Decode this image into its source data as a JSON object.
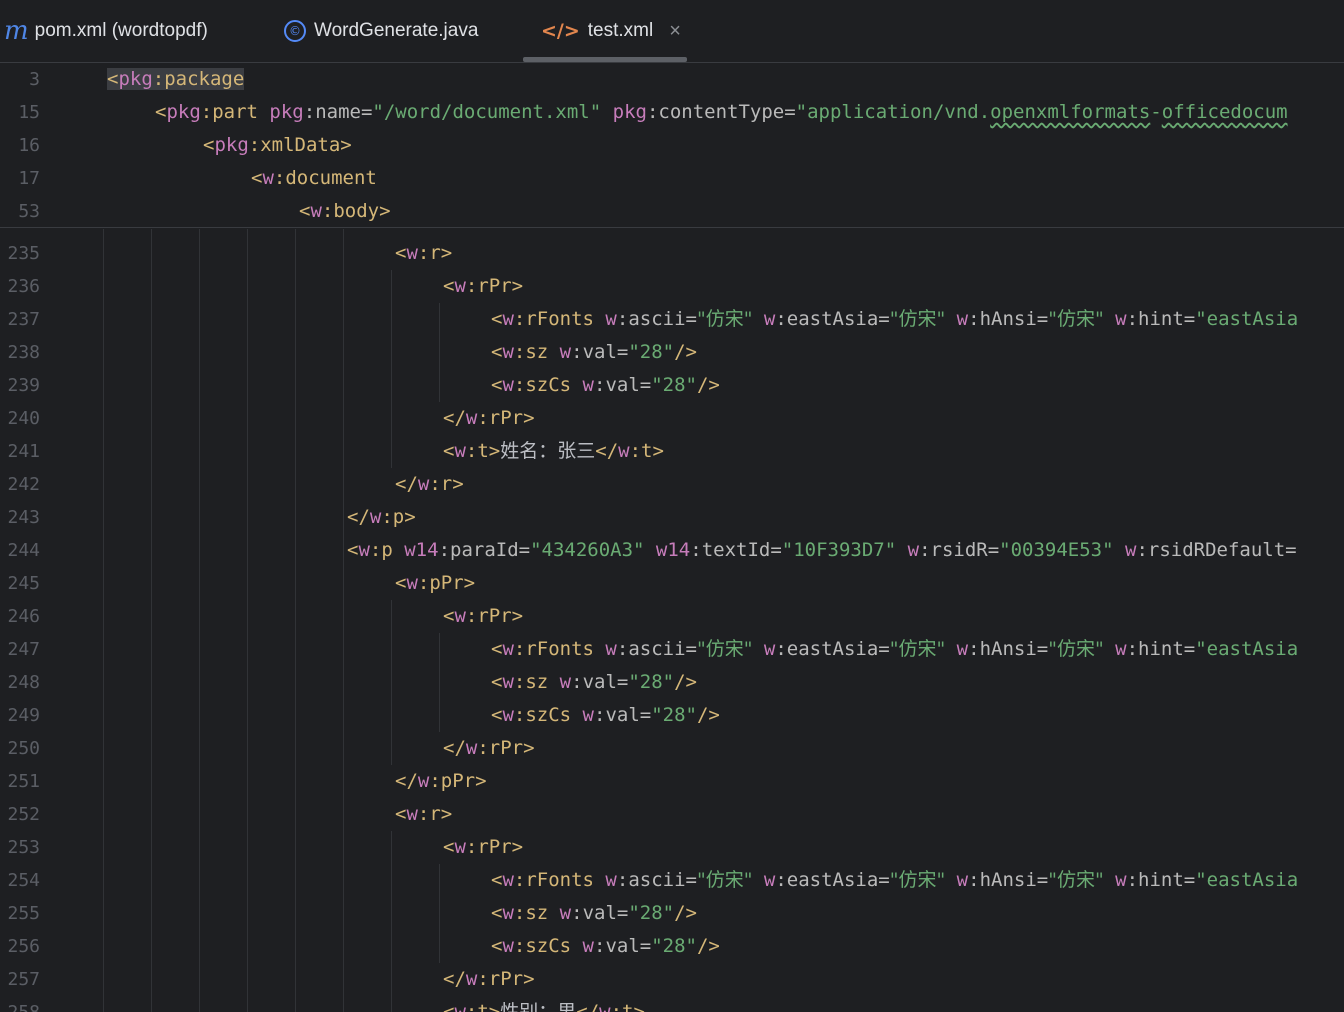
{
  "tabs": [
    {
      "icon": "m",
      "label": "pom.xml (wordtopdf)"
    },
    {
      "icon": "©",
      "label": "WordGenerate.java"
    },
    {
      "icon": "</>",
      "label": "test.xml",
      "close": "×"
    }
  ],
  "sticky_lines": [
    {
      "n": "3",
      "t": [
        "<",
        "pkg",
        ":package"
      ]
    },
    {
      "n": "15",
      "t": [
        "<",
        "pkg",
        ":part ",
        "pkg",
        ":name=",
        "\"/word/document.xml\"",
        " ",
        "pkg",
        ":contentType=",
        "\"application/vnd.",
        "openxmlformats",
        "-",
        "officedocum"
      ]
    },
    {
      "n": "16",
      "t": [
        "<",
        "pkg",
        ":xmlData>"
      ]
    },
    {
      "n": "17",
      "t": [
        "<",
        "w",
        ":document"
      ]
    },
    {
      "n": "53",
      "t": [
        "<",
        "w",
        ":body>"
      ]
    }
  ],
  "lines": [
    {
      "n": "235",
      "t": [
        "<",
        "w",
        ":r>"
      ]
    },
    {
      "n": "236",
      "t": [
        "<",
        "w",
        ":rPr>"
      ]
    },
    {
      "n": "237",
      "t": [
        "<",
        "w",
        ":rFonts ",
        "w",
        ":ascii=",
        "\"仿宋\"",
        " ",
        "w",
        ":eastAsia=",
        "\"仿宋\"",
        " ",
        "w",
        ":hAnsi=",
        "\"仿宋\"",
        " ",
        "w",
        ":hint=",
        "\"eastAsia"
      ]
    },
    {
      "n": "238",
      "t": [
        "<",
        "w",
        ":sz ",
        "w",
        ":val=",
        "\"28\"",
        "/>"
      ]
    },
    {
      "n": "239",
      "t": [
        "<",
        "w",
        ":szCs ",
        "w",
        ":val=",
        "\"28\"",
        "/>"
      ]
    },
    {
      "n": "240",
      "t": [
        "</",
        "w",
        ":rPr>"
      ]
    },
    {
      "n": "241",
      "t": [
        "<",
        "w",
        ":t>",
        "姓名：张三",
        "</",
        "w",
        ":t>"
      ]
    },
    {
      "n": "242",
      "t": [
        "</",
        "w",
        ":r>"
      ]
    },
    {
      "n": "243",
      "t": [
        "</",
        "w",
        ":p>"
      ]
    },
    {
      "n": "244",
      "t": [
        "<",
        "w",
        ":p ",
        "w14",
        ":paraId=",
        "\"434260A3\"",
        " ",
        "w14",
        ":textId=",
        "\"10F393D7\"",
        " ",
        "w",
        ":rsidR=",
        "\"00394E53\"",
        " ",
        "w",
        ":rsidRDefault="
      ]
    },
    {
      "n": "245",
      "t": [
        "<",
        "w",
        ":pPr>"
      ]
    },
    {
      "n": "246",
      "t": [
        "<",
        "w",
        ":rPr>"
      ]
    },
    {
      "n": "247",
      "t": [
        "<",
        "w",
        ":rFonts ",
        "w",
        ":ascii=",
        "\"仿宋\"",
        " ",
        "w",
        ":eastAsia=",
        "\"仿宋\"",
        " ",
        "w",
        ":hAnsi=",
        "\"仿宋\"",
        " ",
        "w",
        ":hint=",
        "\"eastAsia"
      ]
    },
    {
      "n": "248",
      "t": [
        "<",
        "w",
        ":sz ",
        "w",
        ":val=",
        "\"28\"",
        "/>"
      ]
    },
    {
      "n": "249",
      "t": [
        "<",
        "w",
        ":szCs ",
        "w",
        ":val=",
        "\"28\"",
        "/>"
      ]
    },
    {
      "n": "250",
      "t": [
        "</",
        "w",
        ":rPr>"
      ]
    },
    {
      "n": "251",
      "t": [
        "</",
        "w",
        ":pPr>"
      ]
    },
    {
      "n": "252",
      "t": [
        "<",
        "w",
        ":r>"
      ]
    },
    {
      "n": "253",
      "t": [
        "<",
        "w",
        ":rPr>"
      ]
    },
    {
      "n": "254",
      "t": [
        "<",
        "w",
        ":rFonts ",
        "w",
        ":ascii=",
        "\"仿宋\"",
        " ",
        "w",
        ":eastAsia=",
        "\"仿宋\"",
        " ",
        "w",
        ":hAnsi=",
        "\"仿宋\"",
        " ",
        "w",
        ":hint=",
        "\"eastAsia"
      ]
    },
    {
      "n": "255",
      "t": [
        "<",
        "w",
        ":sz ",
        "w",
        ":val=",
        "\"28\"",
        "/>"
      ]
    },
    {
      "n": "256",
      "t": [
        "<",
        "w",
        ":szCs ",
        "w",
        ":val=",
        "\"28\"",
        "/>"
      ]
    },
    {
      "n": "257",
      "t": [
        "</",
        "w",
        ":rPr>"
      ]
    },
    {
      "n": "258",
      "t": [
        "<",
        "w",
        ":t>",
        "性别：男",
        "</",
        "w",
        ":t>"
      ]
    }
  ],
  "colors": {
    "background": "#1e1f22",
    "tag": "#d5b778",
    "namespace": "#c77dbb",
    "attribute": "#bababa",
    "value": "#6aab73",
    "line_number": "#5b5e65"
  }
}
